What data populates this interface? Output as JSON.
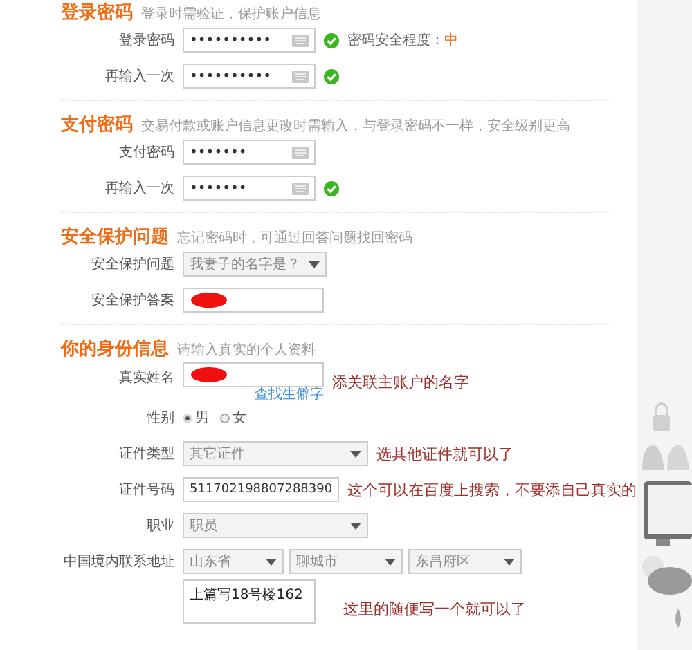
{
  "sections": [
    {
      "title": "登录密码",
      "hint": "登录时需验证，保护账户信息",
      "fields": [
        {
          "kind": "password",
          "label": "登录密码",
          "value": "••••••••••",
          "valid": true,
          "status": "密码安全程度：",
          "strength": "中"
        },
        {
          "kind": "password",
          "label": "再输入一次",
          "value": "••••••••••",
          "valid": true
        }
      ]
    },
    {
      "title": "支付密码",
      "hint": "交易付款或账户信息更改时需输入，与登录密码不一样，安全级别更高",
      "fields": [
        {
          "kind": "password",
          "label": "支付密码",
          "value": "•••••••",
          "valid": false
        },
        {
          "kind": "password",
          "label": "再输入一次",
          "value": "•••••••",
          "valid": true
        }
      ]
    },
    {
      "title": "安全保护问题",
      "hint": "忘记密码时，可通过回答问题找回密码",
      "fields": [
        {
          "kind": "select",
          "label": "安全保护问题",
          "value": "我妻子的名字是？"
        },
        {
          "kind": "text",
          "label": "安全保护答案",
          "redacted": true
        }
      ]
    },
    {
      "title": "你的身份信息",
      "hint": "请输入真实的个人资料",
      "fields": [
        {
          "kind": "text",
          "label": "真实姓名",
          "redacted": true,
          "link": "查找生僻字",
          "note": "添关联主账户的名字"
        },
        {
          "kind": "radio",
          "label": "性别",
          "options": [
            {
              "label": "男",
              "selected": true
            },
            {
              "label": "女",
              "selected": false
            }
          ]
        },
        {
          "kind": "select",
          "label": "证件类型",
          "value": "其它证件",
          "note": "选其他证件就可以了"
        },
        {
          "kind": "text",
          "label": "证件号码",
          "value": "511702198807288390",
          "note": "这个可以在百度上搜索，不要添自己真实的"
        },
        {
          "kind": "select",
          "label": "职业",
          "value": "职员"
        },
        {
          "kind": "address",
          "label": "中国境内联系地址",
          "options": [
            "山东省",
            "聊城市",
            "东昌府区"
          ]
        },
        {
          "kind": "textarea",
          "value": "上篇写18号楼162",
          "note": "这里的随便写一个就可以了"
        }
      ]
    }
  ]
}
